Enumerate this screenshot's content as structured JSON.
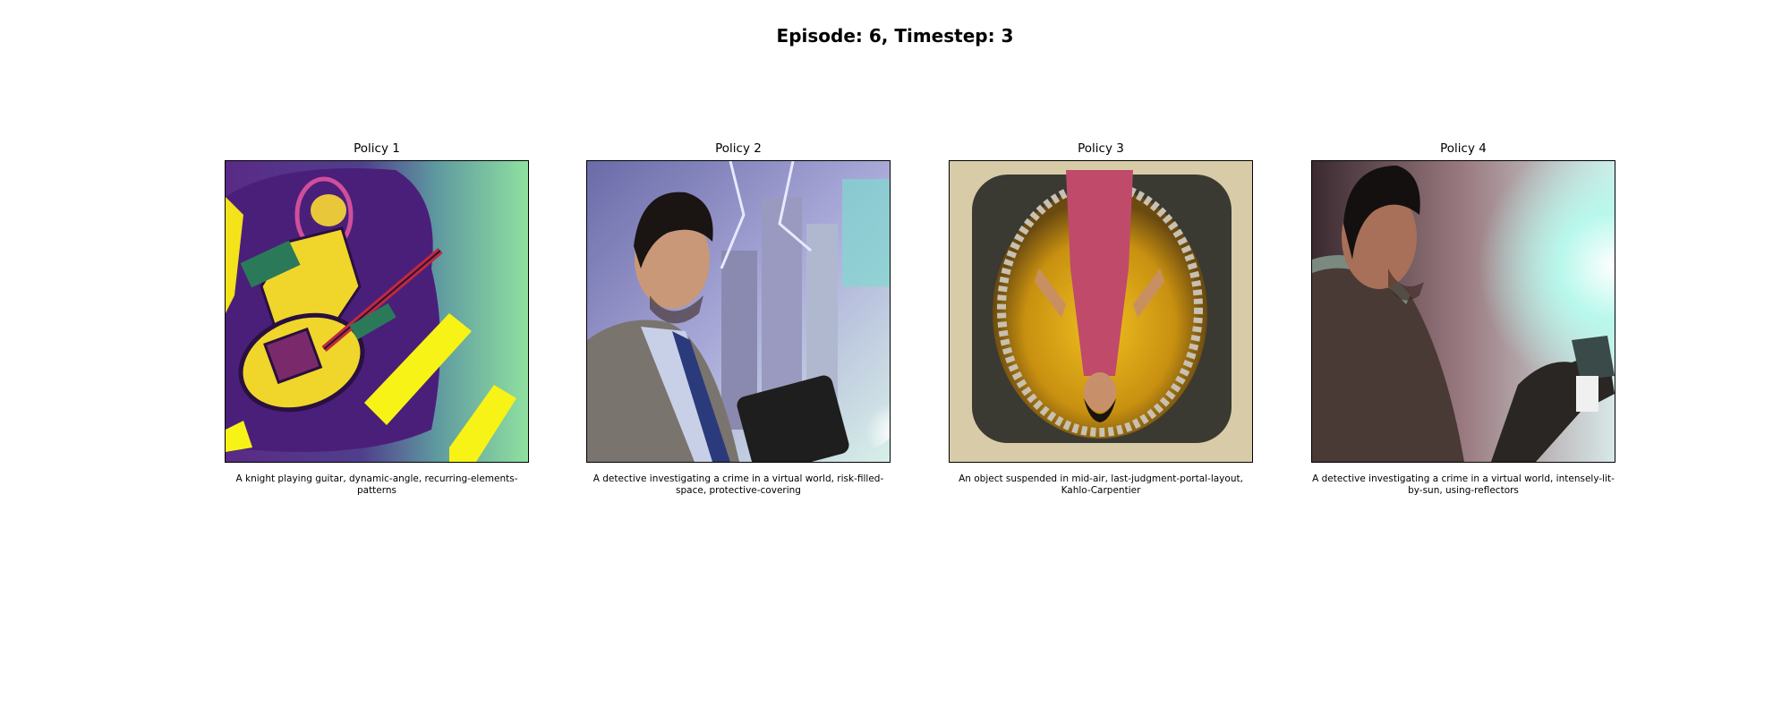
{
  "figure": {
    "title": "Episode: 6, Timestep: 3"
  },
  "panels": [
    {
      "title": "Policy 1",
      "caption": "A knight playing guitar, dynamic-angle, recurring-elements-patterns",
      "image": "abstract-guitar-player-painting"
    },
    {
      "title": "Policy 2",
      "caption": "A detective investigating a crime in a virtual world, risk-filled-space, protective-covering",
      "image": "detective-with-tablet-city-render"
    },
    {
      "title": "Policy 3",
      "caption": "An object suspended in mid-air, last-judgment-portal-layout, Kahlo-Carpentier",
      "image": "inverted-figure-in-golden-portal"
    },
    {
      "title": "Policy 4",
      "caption": "A detective investigating a crime in a virtual world, intensely-lit-by-sun, using-reflectors",
      "image": "detective-backlit-by-sun-render"
    }
  ]
}
